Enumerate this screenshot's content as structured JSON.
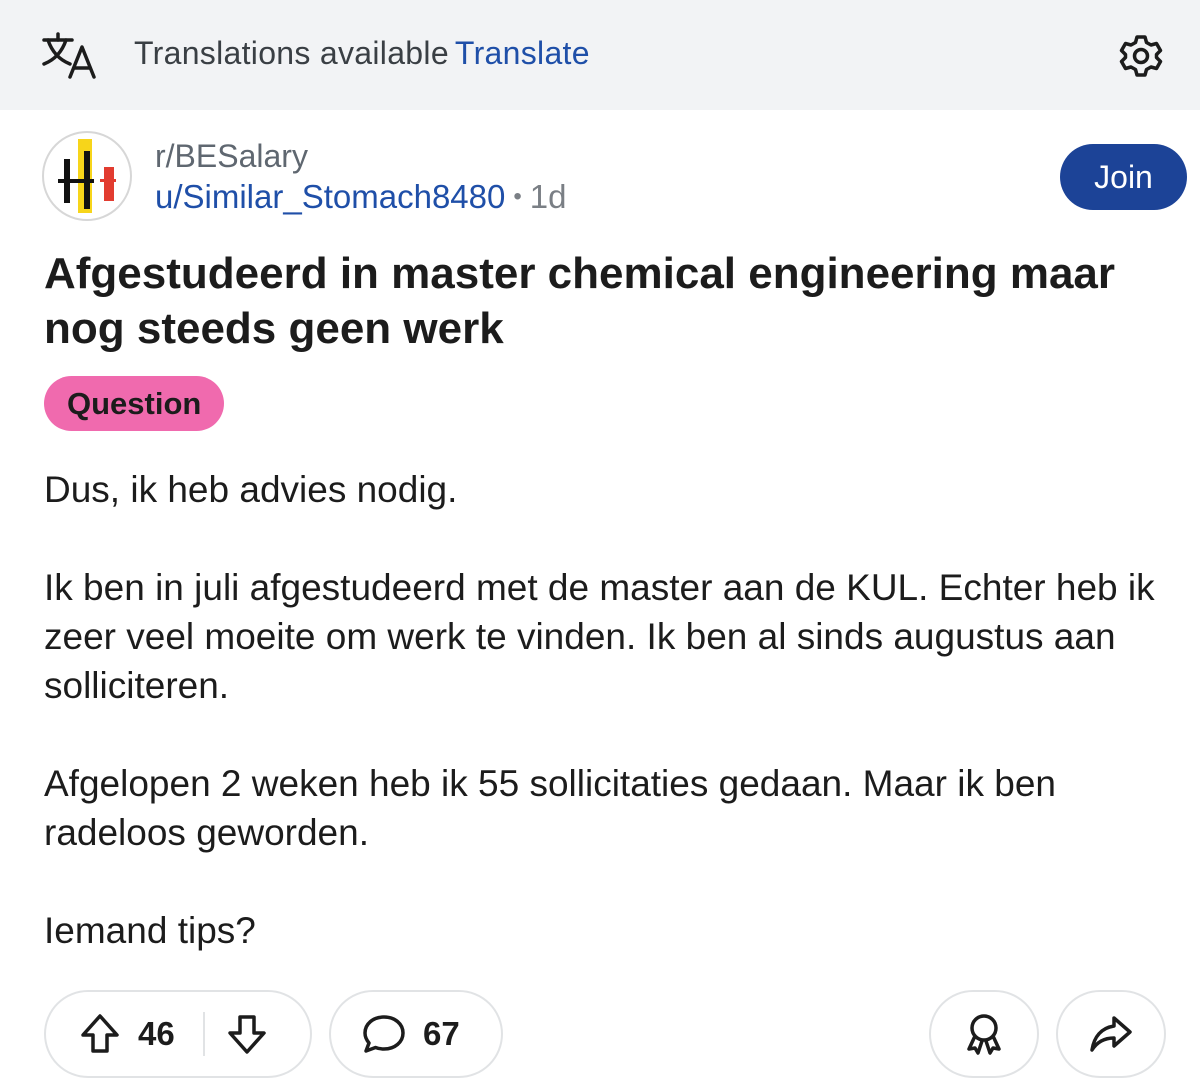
{
  "translation_bar": {
    "message": "Translations available",
    "link": "Translate",
    "icons": [
      "translate-icon",
      "gear-icon"
    ]
  },
  "post": {
    "subreddit": "r/BESalary",
    "author": "u/Similar_Stomach8480",
    "separator": "•",
    "age": "1d",
    "join_label": "Join",
    "title": "Afgestudeerd in master chemical engineering maar nog steeds geen werk",
    "flair": "Question",
    "flair_color": "#f06aae",
    "body": [
      "Dus, ik heb advies nodig.",
      "Ik ben in juli afgestudeerd met de master aan de KUL. Echter heb ik zeer veel moeite om werk te vinden. Ik ben al sinds augustus aan solliciteren.",
      "Afgelopen 2 weken heb ik 55 sollicitaties gedaan. Maar ik ben radeloos geworden.",
      "Iemand tips?"
    ]
  },
  "actions": {
    "upvotes": "46",
    "comments": "67",
    "icons": [
      "upvote-icon",
      "downvote-icon",
      "comment-icon",
      "award-icon",
      "share-icon"
    ]
  },
  "colors": {
    "accent": "#1c4397",
    "link": "#1f4fa8",
    "bar_background": "#f2f3f5"
  }
}
